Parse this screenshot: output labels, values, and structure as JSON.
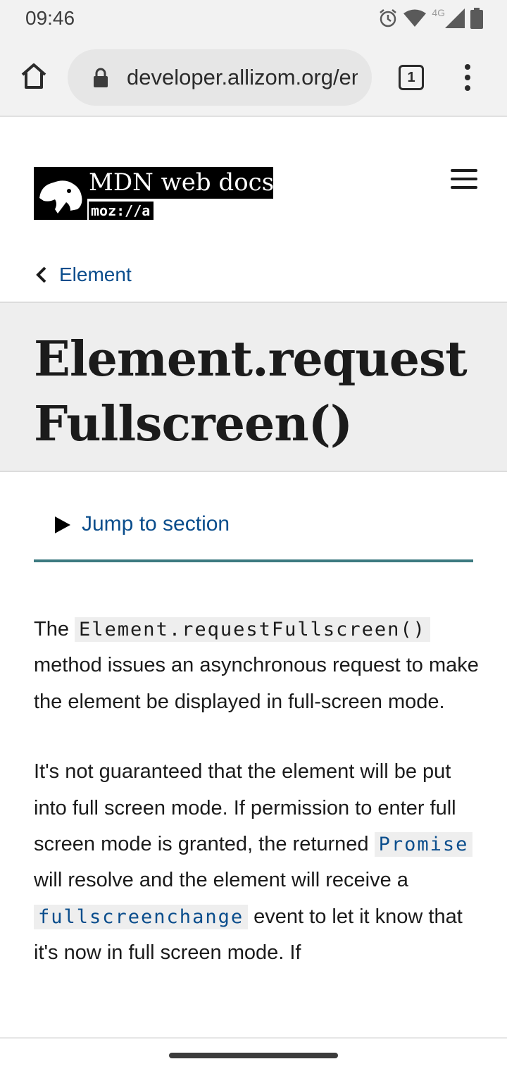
{
  "status_bar": {
    "time": "09:46",
    "network_label": "4G",
    "icons": [
      "alarm-icon",
      "wifi-icon",
      "signal-icon",
      "battery-icon"
    ]
  },
  "browser": {
    "url": "developer.allizom.org/en-US/docs/Web/API/Element/requestFullscreen",
    "tab_count": "1"
  },
  "header": {
    "logo_title": "MDN web docs",
    "logo_subtitle": "moz://a"
  },
  "breadcrumb": {
    "label": "Element"
  },
  "page": {
    "title": "Element.request Fullscreen()",
    "jump_label": "Jump to section"
  },
  "content": {
    "p1_before": "The ",
    "p1_code": "Element.requestFullscreen()",
    "p1_after": " method issues an asynchronous request to make the element be displayed in full-screen mode.",
    "p2_a": "It's not guaranteed that the element will be put into full screen mode. If permission to enter full screen mode is granted, the returned ",
    "p2_code1": "Promise",
    "p2_b": " will resolve and the element will receive a ",
    "p2_code2": "fullscreenchange",
    "p2_c": " event to let it know that it's now in full screen mode. If"
  },
  "colors": {
    "link": "#0a4d8c",
    "jump_underline": "#3c7a80",
    "title_band": "#eeeeee"
  }
}
